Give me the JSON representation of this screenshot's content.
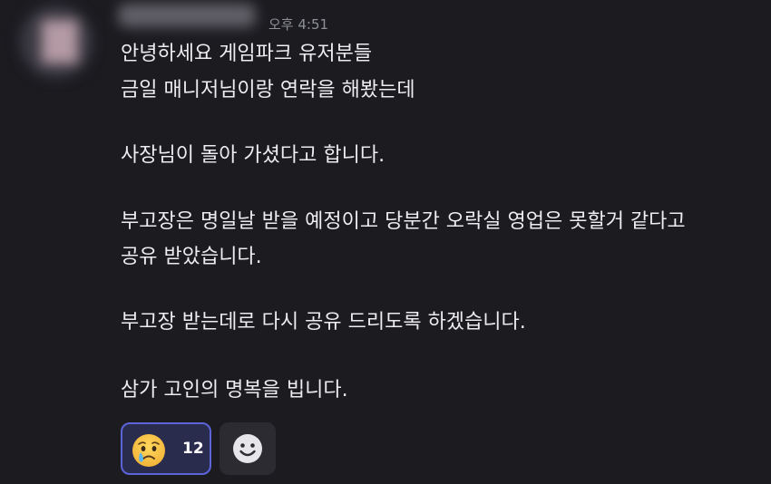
{
  "message": {
    "timestamp": "오후 4:51",
    "lines": [
      "안녕하세요 게임파크 유저분들",
      "금일 매니저님이랑 연락을 해봤는데",
      "",
      "사장님이 돌아 가셨다고 합니다.",
      "",
      "부고장은 명일날 받을 예정이고 당분간 오락실 영업은 못할거 같다고",
      "공유 받았습니다.",
      "",
      "부고장 받는데로 다시 공유 드리도록 하겠습니다.",
      "",
      "삼가 고인의 명복을 빕니다."
    ]
  },
  "reactions": [
    {
      "icon": "crying-face-icon",
      "count": "12",
      "selected": true
    }
  ],
  "add_reaction": {
    "icon": "smiley-face-icon"
  },
  "colors": {
    "background": "#1b1b20",
    "text": "#ededf1",
    "timestamp": "#8f8f98",
    "reaction_active_bg": "#2a2c4d",
    "reaction_active_border": "#5b64d9",
    "reaction_add_bg": "#2b2b31"
  }
}
